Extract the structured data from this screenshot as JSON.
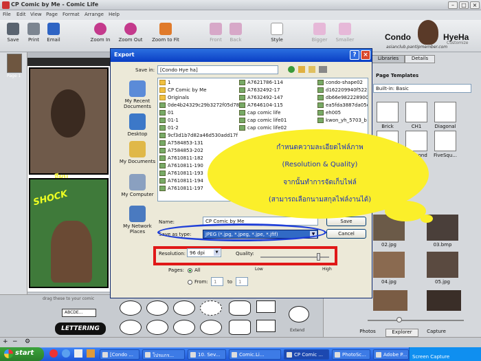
{
  "app": {
    "title": "CP Comic by Me - Comic Life"
  },
  "menu": [
    "File",
    "Edit",
    "View",
    "Page",
    "Format",
    "Arrange",
    "Help"
  ],
  "toolbar": {
    "save": "Save",
    "print": "Print",
    "email": "Email",
    "zoom_in": "Zoom In",
    "zoom_out": "Zoom Out",
    "zoom_fit": "Zoom to Fit",
    "front": "Front",
    "back": "Back",
    "style": "Style",
    "bigger": "Bigger",
    "smaller": "Smaller",
    "customize": "Customize"
  },
  "logo": {
    "name": "Condo",
    "name2": "HyeHa",
    "site": "asianclub.pantipmember.com"
  },
  "pages": {
    "label": "Page 1"
  },
  "comic": {
    "panel1_text": "อีผม",
    "panel2_text": "SHOCK"
  },
  "lettering": {
    "header": "drag these to your comic",
    "text1": "ABCDE...",
    "text2": "LETTERING",
    "extend": "Extend"
  },
  "right_panel": {
    "tabs": [
      "Libraries",
      "Details"
    ],
    "section": "Page Templates",
    "select": "Built-in: Basic",
    "templates": [
      "Brick",
      "CH1",
      "Diagonal",
      "",
      "Diamond",
      "FiveSqu..."
    ],
    "photos": [
      "02.jpg",
      "03.bmp",
      "04.jpg",
      "05.jpg"
    ],
    "bottom_tabs": [
      "Photos",
      "Explorer",
      "Capture"
    ]
  },
  "dialog": {
    "title": "Export",
    "save_in_label": "Save in:",
    "save_in_value": "[Condo Hye ha]",
    "places": [
      "My Recent Documents",
      "Desktop",
      "My Documents",
      "My Computer",
      "My Network Places"
    ],
    "files_col1": [
      "1",
      "CP Comic by Me",
      "Originals",
      "0de4b24329c29b3272f05d78",
      "01",
      "01-1",
      "01-2",
      "9cf3d1b7d82a46d530add17f",
      "A7584853-131",
      "A7584853-202",
      "A7610811-182",
      "A7610811-190",
      "A7610811-193",
      "A7610811-194",
      "A7610811-197"
    ],
    "files_col2": [
      "A7621786-114",
      "A7632492-17",
      "A7632492-147",
      "A7646104-115",
      "cap comic life",
      "cap comic life01",
      "cap comic life02"
    ],
    "files_col3": [
      "condo-shape02",
      "d162209940f5222",
      "db66e982228900b",
      "ea5fda3887da05e",
      "eh005",
      "kwon_yh_5703_b"
    ],
    "name_label": "Name:",
    "name_value": "CP Comic by Me",
    "type_label": "Save as type:",
    "type_value": "JPEG (*.jpg, *.jpeg, *.jpe, *.jfif)",
    "save_btn": "Save",
    "cancel_btn": "Cancel",
    "resolution_label": "Resolution:",
    "resolution_value": "96 dpi",
    "quality_label": "Quality:",
    "quality_low": "Low",
    "quality_high": "High",
    "quality_level": 0.85,
    "pages_label": "Pages:",
    "all_label": "All",
    "from_label": "From:",
    "from_value": "1",
    "to_label": "to",
    "to_value": "1"
  },
  "annotation": [
    "กำหนดความละเอียดไฟล์ภาพ",
    "(Resolution & Quality)",
    "จากนั้นทำการจัดเก็บไฟล์",
    "(สามารถเลือกนามสกุลไฟล์งานได้)"
  ],
  "taskbar": {
    "start": "start",
    "tasks": [
      "[Condo ...",
      "โปรแกร...",
      "10. Sev...",
      "Comic.Li...",
      "CP Comic ...",
      "PhotoSc...",
      "Adobe P..."
    ],
    "tray": "Screen Capture"
  },
  "colors": {
    "xp_blue": "#0a3ec4",
    "annotation_yellow": "#fbef2a",
    "annotation_text": "#1a2fbf",
    "highlight_blue": "#1f3fd8",
    "highlight_red": "#e01818"
  }
}
